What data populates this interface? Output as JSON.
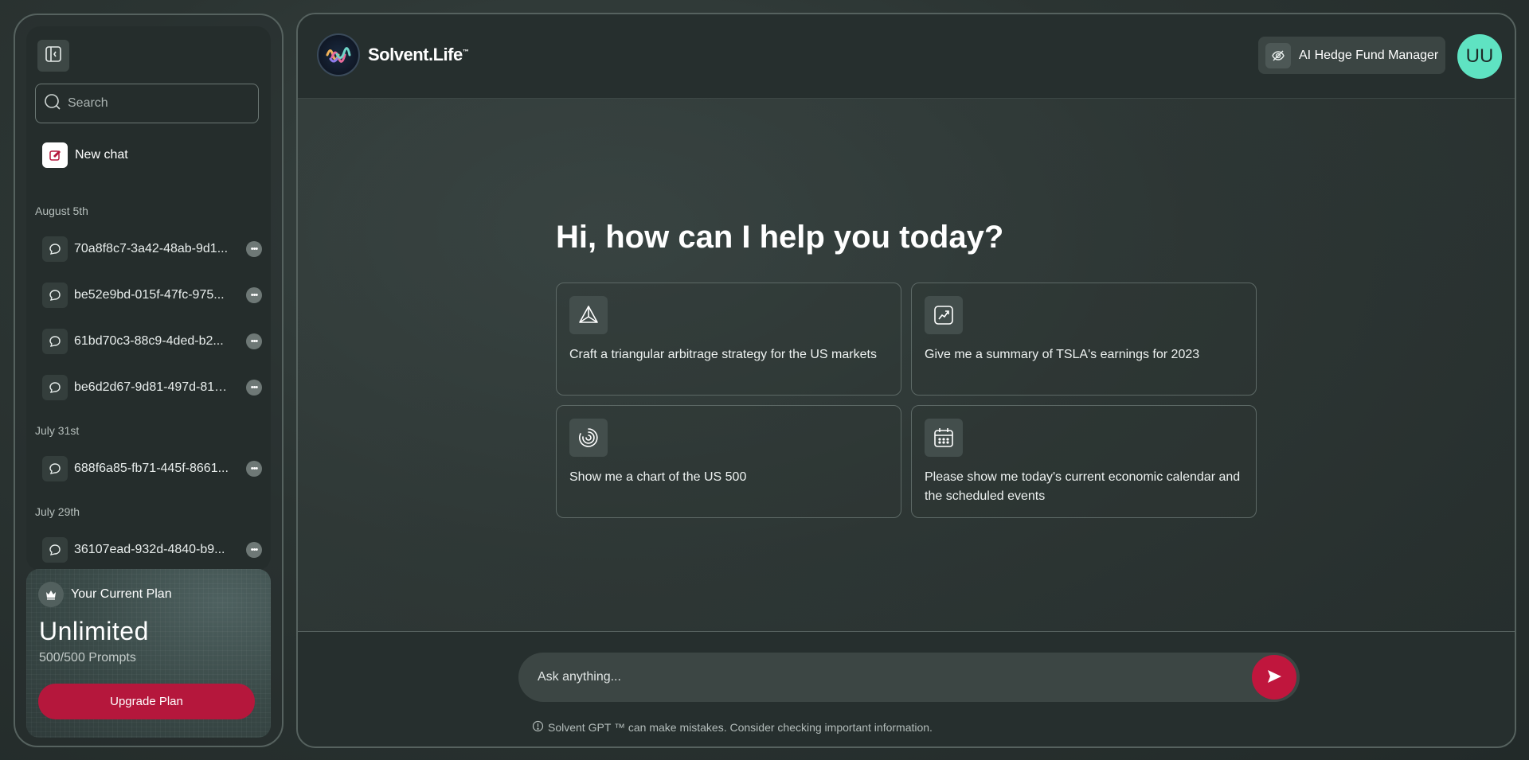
{
  "sidebar": {
    "search_placeholder": "Search",
    "new_chat_label": "New chat",
    "groups": [
      {
        "label": "August 5th"
      },
      {
        "label": "July 31st"
      },
      {
        "label": "July 29th"
      }
    ],
    "chats": [
      {
        "label": "70a8f8c7-3a42-48ab-9d1..."
      },
      {
        "label": "be52e9bd-015f-47fc-975..."
      },
      {
        "label": "61bd70c3-88c9-4ded-b2..."
      },
      {
        "label": "be6d2d67-9d81-497d-81b..."
      },
      {
        "label": "688f6a85-fb71-445f-8661..."
      },
      {
        "label": "36107ead-932d-4840-b9..."
      }
    ],
    "plan": {
      "heading": "Your Current Plan",
      "name": "Unlimited",
      "prompts": "500/500 Prompts",
      "upgrade_label": "Upgrade Plan"
    }
  },
  "header": {
    "logo_text": "Solvent.Life",
    "logo_tm": "™",
    "mode_label": "AI Hedge Fund Manager",
    "avatar_initials": "UU"
  },
  "main": {
    "greeting": "Hi, how can I help you today?",
    "suggestions": [
      {
        "icon": "triangle-icon",
        "text": "Craft a triangular arbitrage strategy for the US markets"
      },
      {
        "icon": "chart-up-icon",
        "text": "Give me a summary of TSLA's earnings for 2023"
      },
      {
        "icon": "spinner-icon",
        "text": "Show me a chart of the US 500"
      },
      {
        "icon": "calendar-icon",
        "text": "Please show me today's current economic calendar and the scheduled events"
      }
    ]
  },
  "composer": {
    "placeholder": "Ask anything...",
    "disclaimer": "Solvent GPT ™ can make mistakes. Consider checking important information."
  },
  "colors": {
    "accent": "#b5173c",
    "avatar": "#5fe3c2"
  }
}
